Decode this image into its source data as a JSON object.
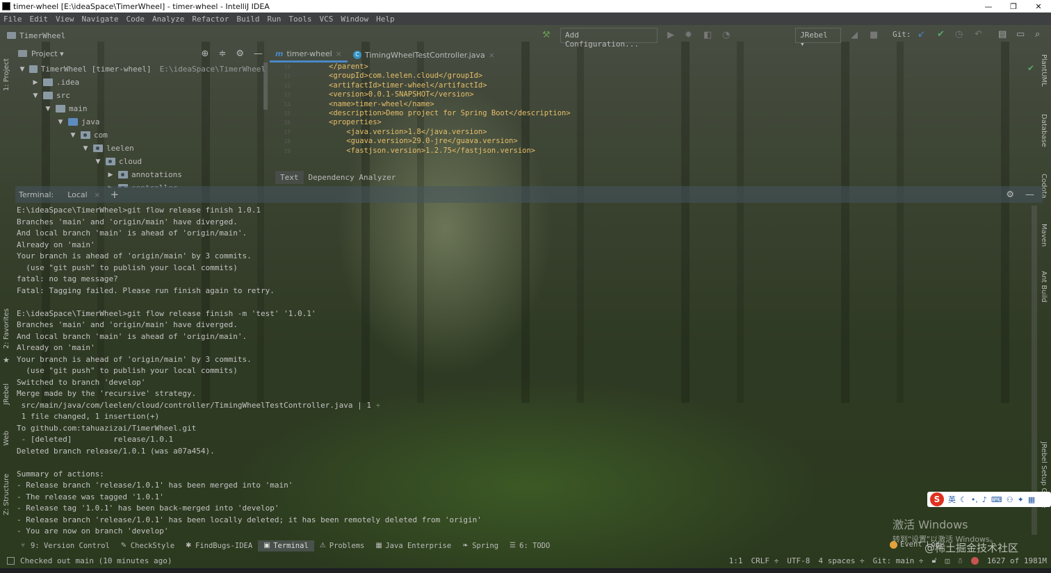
{
  "window": {
    "title": "timer-wheel [E:\\ideaSpace\\TimerWheel] - timer-wheel - IntelliJ IDEA",
    "controls": [
      "—",
      "❐",
      "✕"
    ]
  },
  "menu": [
    "File",
    "Edit",
    "View",
    "Navigate",
    "Code",
    "Analyze",
    "Refactor",
    "Build",
    "Run",
    "Tools",
    "VCS",
    "Window",
    "Help"
  ],
  "navbar": {
    "project": "TimerWheel",
    "add_configuration": "Add Configuration...",
    "jrebel": "JRebel ▾",
    "git_label": "Git:"
  },
  "left_stripe": {
    "project": "1: Project",
    "favorites": "2: Favorites",
    "jrebel": "JRebel",
    "web": "Web",
    "structure": "Z: Structure"
  },
  "right_stripe": {
    "plantuml": "PlantUML",
    "database": "Database",
    "codota": "Codota",
    "maven": "Maven",
    "ant": "Ant Build",
    "jrebel_setup": "JRebel Setup Guide"
  },
  "project_panel": {
    "title": "Project ▾",
    "tree": [
      {
        "name": "TimerWheel [timer-wheel]",
        "path": "E:\\ideaSpace\\TimerWheel",
        "expanded": true,
        "indent": 0
      },
      {
        "name": ".idea",
        "expanded": false,
        "indent": 1
      },
      {
        "name": "src",
        "expanded": true,
        "indent": 1
      },
      {
        "name": "main",
        "expanded": true,
        "indent": 2
      },
      {
        "name": "java",
        "expanded": true,
        "indent": 3,
        "blue": true
      },
      {
        "name": "com",
        "expanded": true,
        "indent": 4,
        "pkg": true
      },
      {
        "name": "leelen",
        "expanded": true,
        "indent": 5,
        "pkg": true
      },
      {
        "name": "cloud",
        "expanded": true,
        "indent": 6,
        "pkg": true
      },
      {
        "name": "annotations",
        "expanded": false,
        "indent": 7,
        "pkg": true
      },
      {
        "name": "controller",
        "expanded": false,
        "indent": 7,
        "pkg": true
      }
    ]
  },
  "editor": {
    "tabs": [
      {
        "label": "timer-wheel",
        "icon": "m",
        "active": true
      },
      {
        "label": "TimingWheelTestController.java",
        "icon": "C",
        "active": false
      }
    ],
    "lines": [
      {
        "num": "10",
        "text": "</parent>"
      },
      {
        "num": "11",
        "text": "<groupId>com.leelen.cloud</groupId>"
      },
      {
        "num": "12",
        "text": "<artifactId>timer-wheel</artifactId>"
      },
      {
        "num": "13",
        "text": "<version>0.0.1-SNAPSHOT</version>"
      },
      {
        "num": "14",
        "text": "<name>timer-wheel</name>"
      },
      {
        "num": "15",
        "text": "<description>Demo project for Spring Boot</description>"
      },
      {
        "num": "16",
        "text": "<properties>"
      },
      {
        "num": "17",
        "text": "    <java.version>1.8</java.version>"
      },
      {
        "num": "18",
        "text": "    <guava.version>29.0-jre</guava.version>"
      },
      {
        "num": "19",
        "text": "    <fastjson.version>1.2.75</fastjson.version>"
      }
    ],
    "subtabs": [
      "Text",
      "Dependency Analyzer"
    ]
  },
  "terminal": {
    "title": "Terminal:",
    "tab": "Local",
    "lines": [
      "E:\\ideaSpace\\TimerWheel>git flow release finish 1.0.1",
      "Branches 'main' and 'origin/main' have diverged.",
      "And local branch 'main' is ahead of 'origin/main'.",
      "Already on 'main'",
      "Your branch is ahead of 'origin/main' by 3 commits.",
      "  (use \"git push\" to publish your local commits)",
      "fatal: no tag message?",
      "Fatal: Tagging failed. Please run finish again to retry.",
      "",
      "E:\\ideaSpace\\TimerWheel>git flow release finish -m 'test' '1.0.1'",
      "Branches 'main' and 'origin/main' have diverged.",
      "And local branch 'main' is ahead of 'origin/main'.",
      "Already on 'main'",
      "Your branch is ahead of 'origin/main' by 3 commits.",
      "  (use \"git push\" to publish your local commits)",
      "Switched to branch 'develop'",
      "Merge made by the 'recursive' strategy.",
      " src/main/java/com/leelen/cloud/controller/TimingWheelTestController.java | 1 +",
      " 1 file changed, 1 insertion(+)",
      "To github.com:tahuazizai/TimerWheel.git",
      " - [deleted]         release/1.0.1",
      "Deleted branch release/1.0.1 (was a07a454).",
      "",
      "Summary of actions:",
      "- Release branch 'release/1.0.1' has been merged into 'main'",
      "- The release was tagged '1.0.1'",
      "- Release tag '1.0.1' has been back-merged into 'develop'",
      "- Release branch 'release/1.0.1' has been locally deleted; it has been remotely deleted from 'origin'",
      "- You are now on branch 'develop'"
    ]
  },
  "toolwindows": [
    {
      "label": "9: Version Control",
      "icon": "⑂"
    },
    {
      "label": "CheckStyle",
      "icon": "✎"
    },
    {
      "label": "FindBugs-IDEA",
      "icon": "✱"
    },
    {
      "label": "Terminal",
      "icon": "▣",
      "active": true
    },
    {
      "label": "Problems",
      "icon": "⚠"
    },
    {
      "label": "Java Enterprise",
      "icon": "▦"
    },
    {
      "label": "Spring",
      "icon": "❧"
    },
    {
      "label": "6: TODO",
      "icon": "☰"
    }
  ],
  "event_log": "Event Log",
  "status": {
    "message": "Checked out main (10 minutes ago)",
    "position": "1:1",
    "line_sep": "CRLF ÷",
    "encoding": "UTF-8",
    "indent": "4 spaces ÷",
    "git_branch": "Git: main ÷",
    "memory": "1627 of 1981M"
  },
  "watermark": {
    "line1": "激活 Windows",
    "line2": "转到\"设置\"以激活 Windows。",
    "site": "@稀土掘金技术社区"
  },
  "ime": {
    "logo": "S",
    "lang": "英"
  },
  "colors": {
    "accent": "#4a88c7",
    "xml_tag": "#e8bf6a",
    "git_add": "#6a8759",
    "ime_red": "#e0311f"
  }
}
